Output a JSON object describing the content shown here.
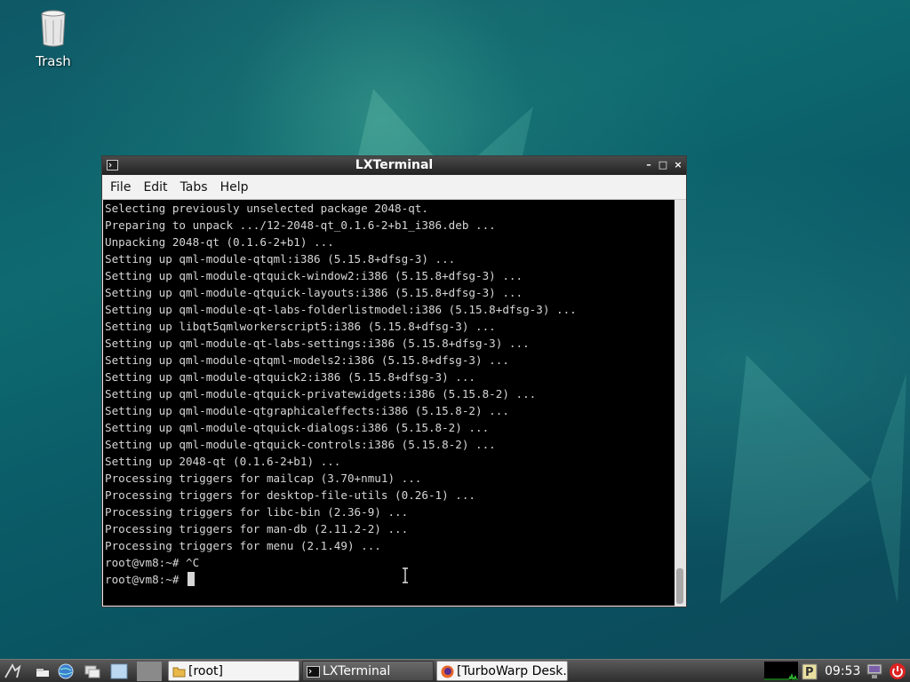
{
  "desktop": {
    "icons": [
      {
        "label": "Trash"
      }
    ]
  },
  "window": {
    "title": "LXTerminal",
    "controls": {
      "minimize": "–",
      "maximize": "□",
      "close": "×"
    },
    "menu": [
      "File",
      "Edit",
      "Tabs",
      "Help"
    ],
    "terminal_lines": [
      "Selecting previously unselected package 2048-qt.",
      "Preparing to unpack .../12-2048-qt_0.1.6-2+b1_i386.deb ...",
      "Unpacking 2048-qt (0.1.6-2+b1) ...",
      "Setting up qml-module-qtqml:i386 (5.15.8+dfsg-3) ...",
      "Setting up qml-module-qtquick-window2:i386 (5.15.8+dfsg-3) ...",
      "Setting up qml-module-qtquick-layouts:i386 (5.15.8+dfsg-3) ...",
      "Setting up qml-module-qt-labs-folderlistmodel:i386 (5.15.8+dfsg-3) ...",
      "Setting up libqt5qmlworkerscript5:i386 (5.15.8+dfsg-3) ...",
      "Setting up qml-module-qt-labs-settings:i386 (5.15.8+dfsg-3) ...",
      "Setting up qml-module-qtqml-models2:i386 (5.15.8+dfsg-3) ...",
      "Setting up qml-module-qtquick2:i386 (5.15.8+dfsg-3) ...",
      "Setting up qml-module-qtquick-privatewidgets:i386 (5.15.8-2) ...",
      "Setting up qml-module-qtgraphicaleffects:i386 (5.15.8-2) ...",
      "Setting up qml-module-qtquick-dialogs:i386 (5.15.8-2) ...",
      "Setting up qml-module-qtquick-controls:i386 (5.15.8-2) ...",
      "Setting up 2048-qt (0.1.6-2+b1) ...",
      "Processing triggers for mailcap (3.70+nmu1) ...",
      "Processing triggers for desktop-file-utils (0.26-1) ...",
      "Processing triggers for libc-bin (2.36-9) ...",
      "Processing triggers for man-db (2.11.2-2) ...",
      "Processing triggers for menu (2.1.49) ...",
      "root@vm8:~# ^C"
    ],
    "prompt": "root@vm8:~# "
  },
  "taskbar": {
    "launchers": [
      "menu-icon",
      "show-desktop-icon",
      "browser-icon",
      "file-manager-icon",
      "workspace-icon"
    ],
    "tasks": [
      {
        "label": "[root]",
        "icon": "folder-icon"
      },
      {
        "label": "LXTerminal",
        "icon": "terminal-icon"
      },
      {
        "label": "[TurboWarp Desk...",
        "icon": "firefox-icon"
      }
    ],
    "clock": "09:53"
  }
}
